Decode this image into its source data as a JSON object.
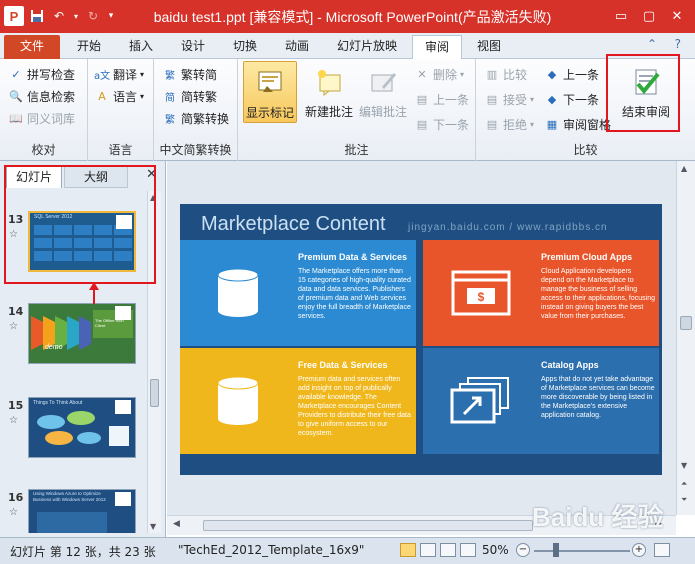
{
  "window": {
    "title": "baidu test1.ppt [兼容模式] - Microsoft PowerPoint(产品激活失败)",
    "app_letter": "P",
    "controls": {
      "minimize": "▭",
      "restore": "▢",
      "close": "✕"
    }
  },
  "tabs": [
    {
      "label": "文件",
      "kind": "file"
    },
    {
      "label": "开始"
    },
    {
      "label": "插入"
    },
    {
      "label": "设计"
    },
    {
      "label": "切换"
    },
    {
      "label": "动画"
    },
    {
      "label": "幻灯片放映"
    },
    {
      "label": "审阅",
      "active": true
    },
    {
      "label": "视图"
    }
  ],
  "ribbon": {
    "proofing": {
      "label": "校对",
      "spellcheck": "拼写检查",
      "research": "信息检索",
      "thesaurus": "同义词库"
    },
    "language": {
      "label": "语言",
      "translate": "翻译",
      "language": "语言"
    },
    "chinese_conversion": {
      "label": "中文简繁转换",
      "to_traditional": "繁转简",
      "to_simplified": "简转繁",
      "convert": "简繁转换"
    },
    "comments": {
      "label": "批注",
      "show_markup": "显示标记",
      "new_comment": "新建批注",
      "edit_comment": "编辑批注",
      "delete": "删除",
      "previous": "上一条",
      "next": "下一条"
    },
    "compare": {
      "label": "比较",
      "compare": "比较",
      "accept": "接受",
      "reject": "拒绝",
      "previous": "上一条",
      "next": "下一条",
      "reviewing_pane": "审阅窗格",
      "end_review": "结束审阅"
    }
  },
  "panel": {
    "tab_slides": "幻灯片",
    "tab_outline": "大纲",
    "close": "✕",
    "thumbnails": [
      {
        "num": "13",
        "selected": true,
        "title": "SQL Server 2012"
      },
      {
        "num": "14",
        "title": "The Offline Rich Client",
        "caption": "demo"
      },
      {
        "num": "15",
        "title": "Things To Think About"
      },
      {
        "num": "16",
        "title": "Using Windows Azure to Optimize Business with Windows Server 2012"
      }
    ]
  },
  "slide": {
    "title": "Marketplace Content",
    "watermark": "jingyan.baidu.com / www.rapidbbs.cn",
    "tiles": [
      {
        "heading": "Premium Data & Services",
        "body": "The Marketplace offers more than 15 categories of high-quality curated data and data services. Publishers of premium data and Web services enjoy the full breadth of Marketplace services.",
        "color": "#2b8ad1"
      },
      {
        "heading": "Premium Cloud Apps",
        "body": "Cloud Application developers depend on the Marketplace to manage the business of selling access to their applications, focusing instead on giving buyers the best value from their purchases.",
        "color": "#e9552a"
      },
      {
        "heading": "Free Data & Services",
        "body": "Premium data and services often add insight on top of publically available knowledge. The Marketplace encourages Content Providers to distribute their free data to give uniform access to our ecosystem.",
        "color": "#f0b71c"
      },
      {
        "heading": "Catalog Apps",
        "body": "Apps that do not yet take advantage of Marketplace services can become more discoverable by being listed in the Marketplace's extensive application catalog.",
        "color": "#2c6fae"
      }
    ]
  },
  "status": {
    "slide_info": "幻灯片 第 12 张，共 23 张",
    "theme": "\"TechEd_2012_Template_16x9\"",
    "zoom": "50%",
    "zoom_fraction": 0.5
  },
  "watermark_brand": "Baidu 经验",
  "colors": {
    "accent": "#d24726",
    "highlight": "#e2171e",
    "slide_bg": "#1f4f82"
  }
}
